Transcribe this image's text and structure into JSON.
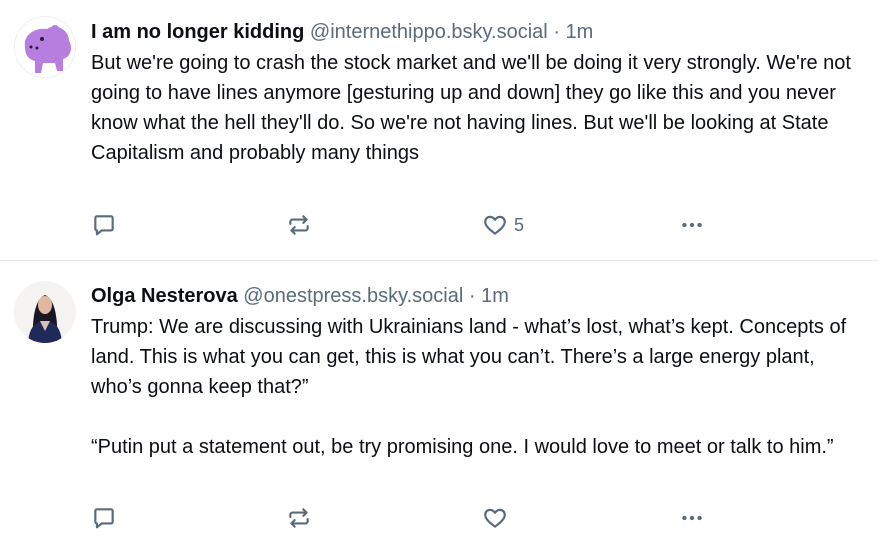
{
  "posts": [
    {
      "author_name": "I am no longer kidding",
      "handle": "@internethippo.bsky.social",
      "separator": "·",
      "time": "1m",
      "text": "But we're going to crash the stock market and we'll be doing it very strongly. We're not going to have lines anymore [gesturing up and down] they go like this and you never know what the hell they'll do. So we're not having lines. But we'll be looking at State Capitalism and probably many things",
      "like_count": "5"
    },
    {
      "author_name": "Olga Nesterova",
      "handle": "@onestpress.bsky.social",
      "separator": "·",
      "time": "1m",
      "text": "Trump: We are discussing with Ukrainians land - what’s lost, what’s kept. Concepts of land. This is what you can get, this is what you can’t. There’s a large energy plant, who’s gonna keep that?”\n\n“Putin put a statement out, be try promising one. I would love to meet or talk to him.”",
      "like_count": ""
    }
  ],
  "colors": {
    "text": "#0b0f14",
    "muted": "#5b6b7b",
    "divider": "#e3e8ee",
    "hippo_avatar": "#b77ee0"
  },
  "icons": [
    "reply-icon",
    "repost-icon",
    "like-icon",
    "more-icon"
  ]
}
